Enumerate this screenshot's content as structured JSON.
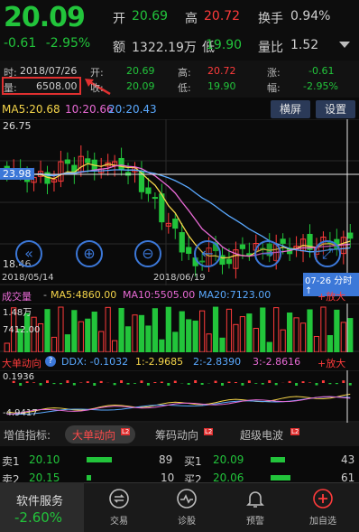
{
  "header": {
    "price": "20.09",
    "change": "-0.61",
    "change_pct": "-2.95%",
    "open_label": "开",
    "open_value": "20.69",
    "high_label": "高",
    "high_value": "20.72",
    "turnover_label": "换手",
    "turnover_value": "0.94%",
    "amount_label": "额",
    "amount_value": "1322.19万",
    "low_label": "低",
    "low_value": "19.90",
    "volratio_label": "量比",
    "volratio_value": "1.52"
  },
  "info": {
    "time_key": "时:",
    "time_val": "2018/07/26",
    "vol_key": "量:",
    "vol_val": "6508.00",
    "open_key": "开:",
    "open_val": "20.69",
    "close_key": "收:",
    "close_val": "20.09",
    "high_key": "高:",
    "high_val": "20.72",
    "low_key": "低:",
    "low_val": "19.90",
    "chg_key": "涨:",
    "chg_val": "-0.61",
    "amp_key": "幅:",
    "amp_val": "-2.95%"
  },
  "ma": {
    "ma5": "MA5:20.68",
    "ma10": "10:20.66",
    "ma20": "20:20.43",
    "landscape_btn": "横屏",
    "settings_btn": "设置"
  },
  "kchart": {
    "top_price": "26.75",
    "cross_price": "23.98",
    "low_price": "18.46",
    "date_left": "2018/05/14",
    "date_mid": "2018/06/19",
    "timeshare_btn": "07-26 分时↑"
  },
  "volume": {
    "title": "成交量",
    "ma5": "MA5:4860.00",
    "ma10": "MA10:5505.00",
    "ma20": "MA20:7123.00",
    "zoom": "+放大",
    "top_label": "1.48万",
    "mid_label": "7412.00"
  },
  "bigorder": {
    "title": "大单动向",
    "ddx": "DDX: -0.1032",
    "v1": "1:-2.9685",
    "v2": "2:-2.8390",
    "v3": "3:-2.8616",
    "zoom": "+放大",
    "top_label": "0.1936",
    "bottom_label": "-4.9417"
  },
  "tabs": {
    "label": "增值指标:",
    "items": [
      "大单动向",
      "筹码动向",
      "超级电波"
    ],
    "badge": "L2"
  },
  "orderbook": {
    "sell1_label": "卖1",
    "sell1_price": "20.10",
    "sell1_vol": "89",
    "sell2_label": "卖2",
    "sell2_price": "20.15",
    "sell2_vol": "10",
    "buy1_label": "买1",
    "buy1_price": "20.09",
    "buy1_vol": "43",
    "buy2_label": "买2",
    "buy2_price": "20.06",
    "buy2_vol": "61"
  },
  "nav": {
    "service_label": "软件服务",
    "service_value": "-2.60%",
    "items": [
      "交易",
      "诊股",
      "预警",
      "加自选"
    ]
  },
  "colors": {
    "up": "#ff3b3b",
    "down": "#22c43b",
    "accent": "#3c78d8"
  }
}
